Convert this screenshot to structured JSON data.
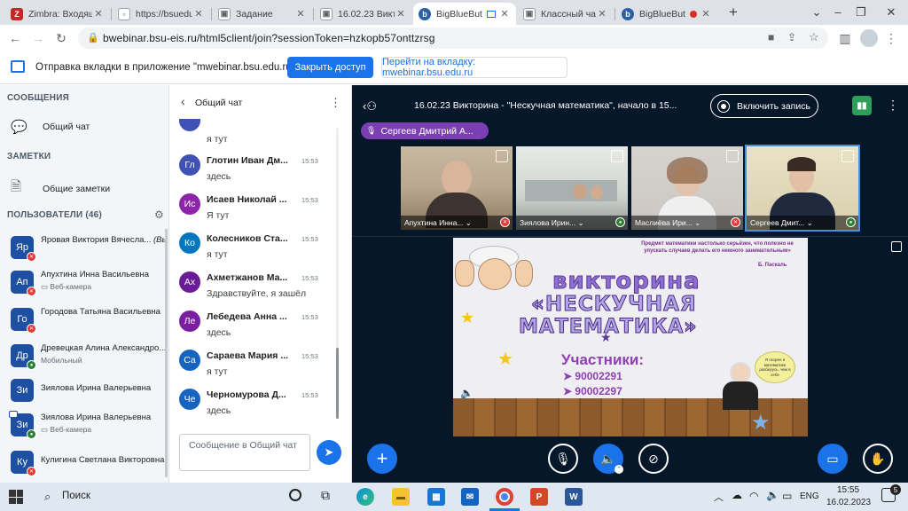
{
  "browser": {
    "tabs": [
      {
        "title": "Zimbra: Входящ",
        "active": false
      },
      {
        "title": "https://bsuedu",
        "active": false
      },
      {
        "title": "Задание",
        "active": false
      },
      {
        "title": "16.02.23 Викто",
        "active": false
      },
      {
        "title": "BigBlueBut",
        "active": true
      },
      {
        "title": "Классный час",
        "active": false
      },
      {
        "title": "BigBlueBut",
        "active": false
      }
    ],
    "new_tab": "+",
    "url": "bwebinar.bsu-eis.ru/html5client/join?sessionToken=hzkopb57onttzrsg",
    "infobar": {
      "text": "Отправка вкладки в приложение \"mwebinar.bsu.edu.ru\"...",
      "share_button": "Закрыть доступ",
      "switch_button": "Перейти на вкладку: mwebinar.bsu.edu.ru"
    }
  },
  "sidebar": {
    "messages_header": "СООБЩЕНИЯ",
    "public_chat": "Общий чат",
    "notes_header": "ЗАМЕТКИ",
    "shared_notes": "Общие заметки",
    "users_header": "ПОЛЬЗОВАТЕЛИ (46)",
    "users": [
      {
        "initials": "Яр",
        "name": "Яровая Виктория Вячесла...",
        "you": "(Вы)",
        "sub": "",
        "color": "#1e4fa3",
        "mic": "muted"
      },
      {
        "initials": "Ап",
        "name": "Апухтина Инна Васильевна",
        "you": "",
        "sub": "Веб-камера",
        "color": "#1e4fa3",
        "mic": "muted"
      },
      {
        "initials": "Го",
        "name": "Городова Татьяна Васильевна",
        "you": "",
        "sub": "",
        "color": "#1e4fa3",
        "mic": "muted"
      },
      {
        "initials": "Др",
        "name": "Древецкая Алина Александро...",
        "you": "",
        "sub": "Мобильный",
        "color": "#1e4fa3",
        "mic": "on"
      },
      {
        "initials": "Зи",
        "name": "Зиялова Ирина Валерьевна",
        "you": "",
        "sub": "",
        "color": "#1e4fa3",
        "mic": "none"
      },
      {
        "initials": "Зи",
        "name": "Зиялова Ирина Валерьевна",
        "you": "",
        "sub": "Веб-камера",
        "color": "#1e4fa3",
        "mic": "on"
      },
      {
        "initials": "Ку",
        "name": "Кулигина Светлана Викторовна",
        "you": "",
        "sub": "",
        "color": "#1e4fa3",
        "mic": "muted"
      }
    ]
  },
  "chat": {
    "title": "Общий чат",
    "first_partial_text": "я тут",
    "messages": [
      {
        "initials": "Гл",
        "name": "Глотин Иван Дм...",
        "time": "15:53",
        "text": "здесь",
        "color": "#3f51b5"
      },
      {
        "initials": "Ис",
        "name": "Исаев Николай ...",
        "time": "15:53",
        "text": "Я тут",
        "color": "#8e24aa"
      },
      {
        "initials": "Ко",
        "name": "Колесников Ста...",
        "time": "15:53",
        "text": "я тут",
        "color": "#0277bd"
      },
      {
        "initials": "Ах",
        "name": "Ахметжанов Ма...",
        "time": "15:53",
        "text": "Здравствуйте, я зашёл",
        "color": "#6a1b9a"
      },
      {
        "initials": "Ле",
        "name": "Лебедева Анна ...",
        "time": "15:53",
        "text": "здесь",
        "color": "#7b1fa2"
      },
      {
        "initials": "Са",
        "name": "Сараева Мария ...",
        "time": "15:53",
        "text": "я тут",
        "color": "#1565c0"
      },
      {
        "initials": "Че",
        "name": "Черномурова Д...",
        "time": "15:53",
        "text": "здесь",
        "color": "#1565c0"
      }
    ],
    "input_placeholder": "Сообщение в Общий чат"
  },
  "meeting": {
    "title": "16.02.23 Викторина - \"Нескучная математика\", начало в 15...",
    "record_button": "Включить запись",
    "talker": "Сергеев Дмитрий А...",
    "videos": [
      {
        "name": "Апухтина Инна...",
        "mic": "muted"
      },
      {
        "name": "Зиялова Ирин...",
        "mic": "on"
      },
      {
        "name": "Маслиёва Ири...",
        "mic": "muted"
      },
      {
        "name": "Сергеев Дмит...",
        "mic": "on"
      }
    ],
    "slide": {
      "quote": "Предмет математики настолько серьёзен, что полезно не упускать случаев делать его немного занимательным»",
      "quote_author": "Б. Паскаль",
      "title1": "викторина",
      "title2": "«НЕСКУЧНАЯ",
      "title3": "МАТЕМАТИКА»",
      "participants_label": "Участники:",
      "participants": [
        "90002291",
        "90002297"
      ],
      "bubble": "Я скорее в математике разберусь, чем в себе"
    }
  },
  "taskbar": {
    "search": "Поиск",
    "lang": "ENG",
    "time": "15:55",
    "date": "16.02.2023"
  }
}
